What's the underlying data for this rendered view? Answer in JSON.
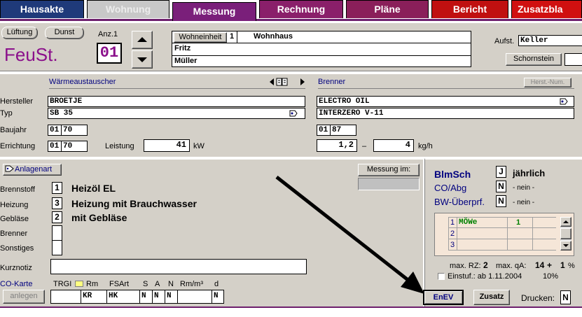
{
  "tabs": [
    {
      "label": "Hausakte",
      "bg": "#1f3a7a",
      "fg": "#ffffff"
    },
    {
      "label": "Wohnung",
      "bg": "#c8c8c8",
      "fg": "#ececec"
    },
    {
      "label": "Messung",
      "bg": "#7a1f7a",
      "fg": "#ffffff"
    },
    {
      "label": "Rechnung",
      "bg": "#8a1f6a",
      "fg": "#ffffff"
    },
    {
      "label": "Pläne",
      "bg": "#8a1f5a",
      "fg": "#ffffff"
    },
    {
      "label": "Bericht",
      "bg": "#c01010",
      "fg": "#ffffff"
    },
    {
      "label": "Zusatzbla",
      "bg": "#d01010",
      "fg": "#ffffff"
    }
  ],
  "header": {
    "lueftung": "Lüftung",
    "dunst": "Dunst",
    "anz_label": "Anz.1",
    "feust": "FeuSt.",
    "anz_value": "01",
    "wohneinheit_label": "Wohneinheit",
    "wohneinheit_value": "1",
    "wohnhaus": "Wohnhaus",
    "name1": "Fritz",
    "name2": "Müller",
    "aufst_label": "Aufst.",
    "aufst_value": "Keller",
    "schornstein": "Schornstein"
  },
  "waermetauscher": {
    "title": "Wärmeaustauscher",
    "hersteller_label": "Hersteller",
    "hersteller": "BROETJE",
    "typ_label": "Typ",
    "typ": "SB 35",
    "baujahr_label": "Baujahr",
    "baujahr_m": "01",
    "baujahr_y": "70",
    "errichtung_label": "Errichtung",
    "errichtung_m": "01",
    "errichtung_y": "70",
    "leistung_label": "Leistung",
    "leistung": "41",
    "leistung_unit": "kW"
  },
  "brenner": {
    "title": "Brenner",
    "herst_num": "Herst.-Num.",
    "hersteller": "ELECTRO OIL",
    "typ": "INTERZERO V-11",
    "baujahr_m": "01",
    "baujahr_y": "87",
    "durchsatz_min": "1,2",
    "dash": "–",
    "durchsatz_max": "4",
    "unit": "kg/h"
  },
  "anlage": {
    "anlagenart": "Anlagenart",
    "messung_im": "Messung im:",
    "brennstoff_label": "Brennstoff",
    "brennstoff_code": "1",
    "brennstoff": "Heizöl EL",
    "heizung_label": "Heizung",
    "heizung_code": "3",
    "heizung": "Heizung mit Brauchwasser",
    "geblaese_label": "Gebläse",
    "geblaese_code": "2",
    "geblaese": "mit Gebläse",
    "brenner_label": "Brenner",
    "sonstiges_label": "Sonstiges",
    "kurznotiz_label": "Kurznotiz",
    "cokarte_label": "CO-Karte",
    "anlegen": "anlegen",
    "trgi": "TRGI",
    "rm": "Rm",
    "fsart": "FSArt",
    "s": "S",
    "a": "A",
    "n": "N",
    "rm3": "Rm/m³",
    "d": "d",
    "fsart_value": "KR",
    "hk_value": "HK",
    "s_value": "N",
    "a_value": "N",
    "n_value": "N",
    "d_value": "N"
  },
  "right": {
    "blmsch": "BlmSch",
    "blmsch_code": "J",
    "blmsch_text": "jährlich",
    "coabg": "CO/Abg",
    "coabg_code": "N",
    "coabg_text": "- nein -",
    "bwuebprf": "BW-Überprf.",
    "bw_code": "N",
    "bw_text": "- nein -",
    "grid_rows": [
      {
        "num": "1",
        "name": "MÖWe",
        "val": "1"
      },
      {
        "num": "2",
        "name": "",
        "val": ""
      },
      {
        "num": "3",
        "name": "",
        "val": ""
      }
    ],
    "max_rz_label": "max. RZ:",
    "max_rz": "2",
    "max_qa_label": "max. qA:",
    "max_qa": "14",
    "plus": "+",
    "max_qa2": "1",
    "percent": "%",
    "einstuf": "Einstuf.: ab 1.11.2004",
    "einstuf_pct": "10%",
    "enev": "EnEV",
    "zusatz": "Zusatz",
    "drucken_label": "Drucken:",
    "drucken": "N"
  },
  "colors": {
    "panel": "#d4d0c8",
    "title_purple": "#8b108b",
    "accent_blue": "#00007f",
    "grid_bg": "#f5e6d8"
  }
}
